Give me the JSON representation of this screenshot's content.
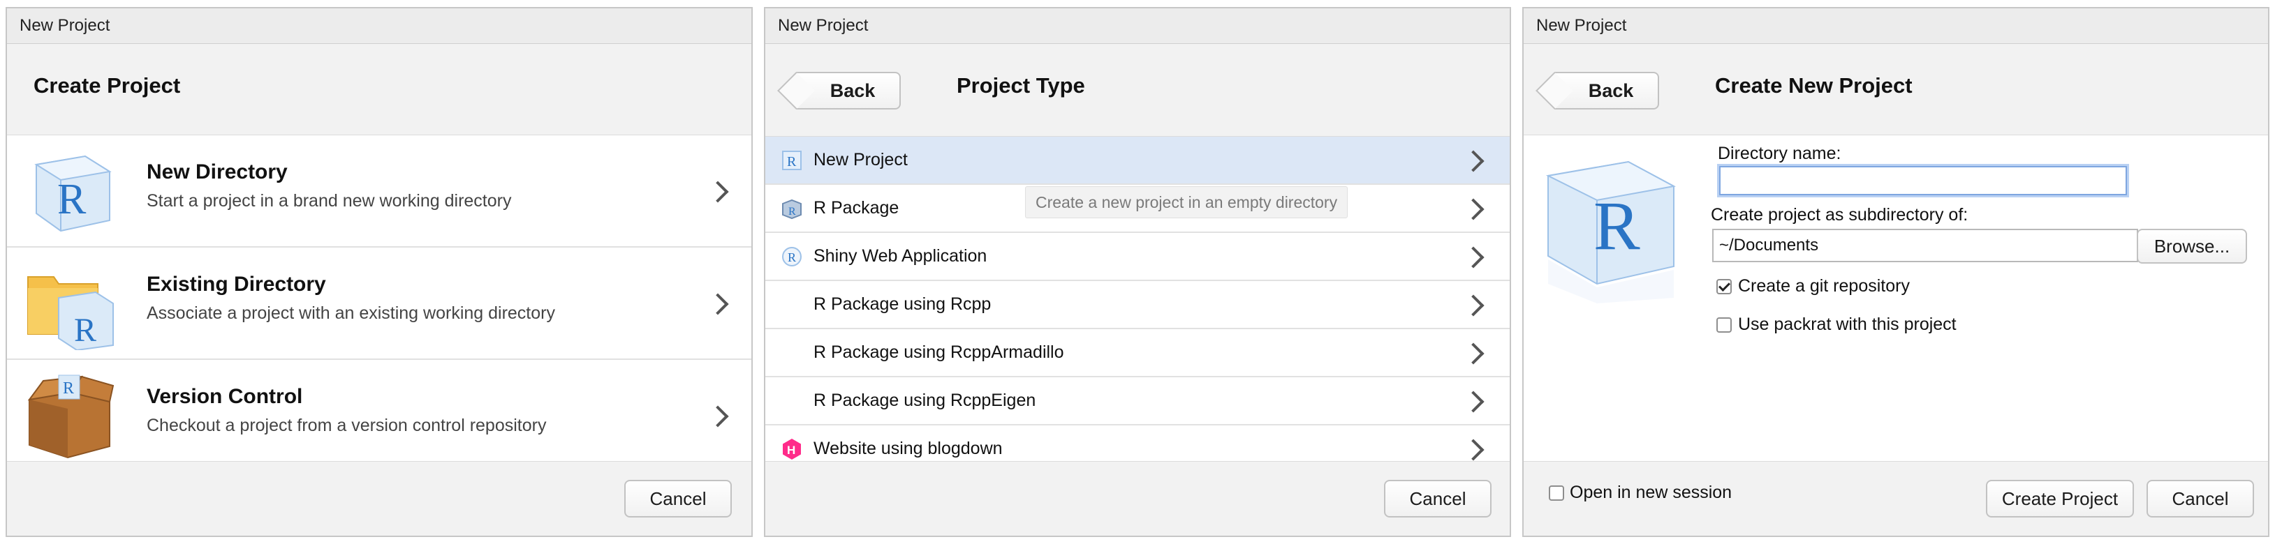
{
  "dialog1": {
    "window_title": "New Project",
    "header_title": "Create Project",
    "rows": [
      {
        "title": "New Directory",
        "desc": "Start a project in a brand new working directory",
        "icon": "r-cube-icon"
      },
      {
        "title": "Existing Directory",
        "desc": "Associate a project with an existing working directory",
        "icon": "folder-r-icon"
      },
      {
        "title": "Version Control",
        "desc": "Checkout a project from a version control repository",
        "icon": "box-icon"
      }
    ],
    "cancel_label": "Cancel"
  },
  "dialog2": {
    "window_title": "New Project",
    "back_label": "Back",
    "header_title": "Project Type",
    "rows": [
      {
        "label": "New Project",
        "icon": "r-project-icon",
        "selected": true
      },
      {
        "label": "R Package",
        "icon": "r-package-icon"
      },
      {
        "label": "Shiny Web Application",
        "icon": "shiny-icon"
      },
      {
        "label": "R Package using Rcpp",
        "icon": ""
      },
      {
        "label": "R Package using RcppArmadillo",
        "icon": ""
      },
      {
        "label": "R Package using RcppEigen",
        "icon": ""
      },
      {
        "label": "Website using blogdown",
        "icon": "hugo-icon"
      }
    ],
    "tooltip": "Create a new project in an empty directory",
    "cancel_label": "Cancel"
  },
  "dialog3": {
    "window_title": "New Project",
    "back_label": "Back",
    "header_title": "Create New Project",
    "directory_name_label": "Directory name:",
    "directory_name_value": "",
    "subdir_label": "Create project as subdirectory of:",
    "subdir_value": "~/Documents",
    "browse_label": "Browse...",
    "git_label": "Create a git repository",
    "git_checked": true,
    "packrat_label": "Use packrat with this project",
    "packrat_checked": false,
    "open_session_label": "Open in new session",
    "create_label": "Create Project",
    "cancel_label": "Cancel"
  },
  "colors": {
    "selected_row": "#dce7f6",
    "r_blue": "#2a74c5",
    "hugo_pink": "#ff2b8a"
  }
}
